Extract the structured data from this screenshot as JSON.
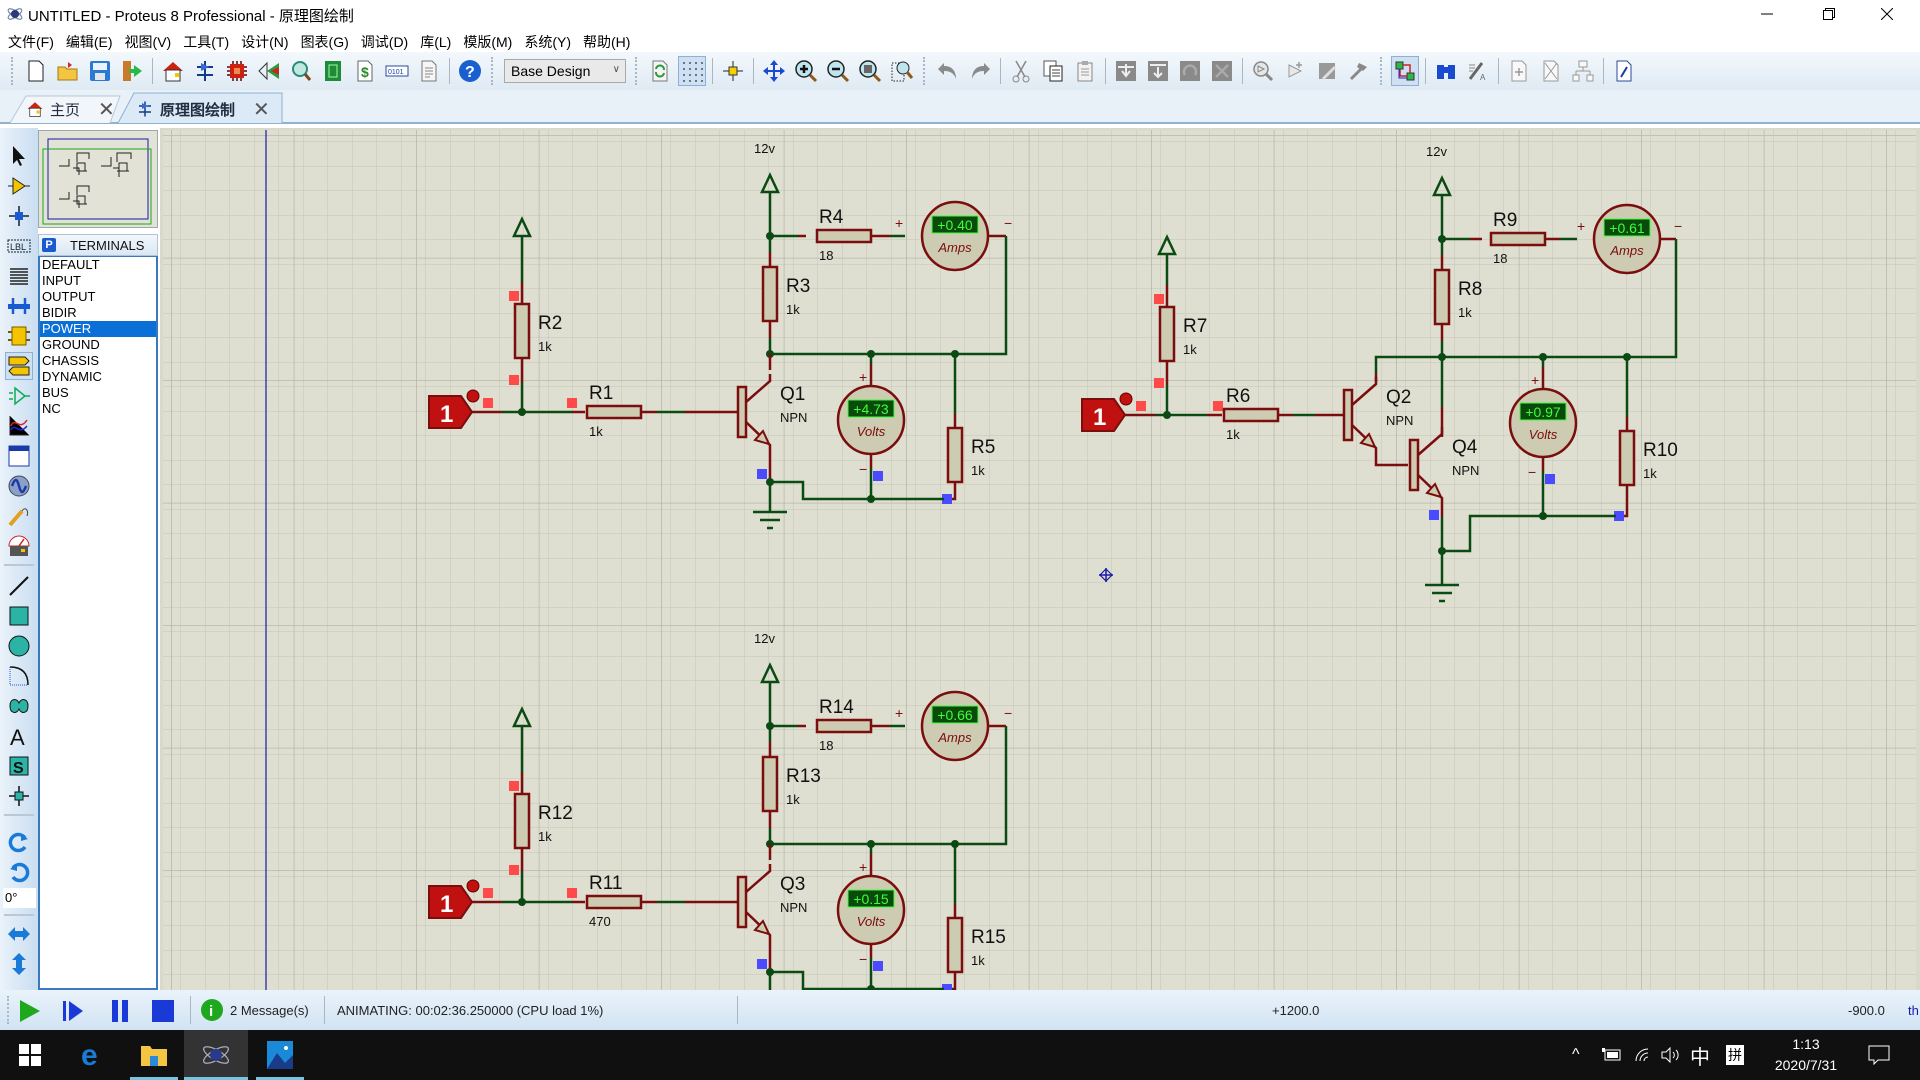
{
  "window": {
    "title": "UNTITLED - Proteus 8 Professional - 原理图绘制",
    "controls": {
      "minimize": "minimize-icon",
      "restore": "restore-icon",
      "close": "close-icon"
    }
  },
  "menu": [
    {
      "label": "文件(F)"
    },
    {
      "label": "编辑(E)"
    },
    {
      "label": "视图(V)"
    },
    {
      "label": "工具(T)"
    },
    {
      "label": "设计(N)"
    },
    {
      "label": "图表(G)"
    },
    {
      "label": "调试(D)"
    },
    {
      "label": "库(L)"
    },
    {
      "label": "模版(M)"
    },
    {
      "label": "系统(Y)"
    },
    {
      "label": "帮助(H)"
    }
  ],
  "toolbar": {
    "design_select": {
      "value": "Base Design"
    },
    "groups": [
      [
        "new-file-icon",
        "open-file-icon",
        "save-icon",
        "import-icon"
      ],
      [
        "home-icon",
        "schematic-icon",
        "pcb-icon",
        "3d-view-icon",
        "gerber-icon",
        "pcb-layout-icon",
        "bom-icon",
        "source-code-icon",
        "notes-icon"
      ],
      [
        "help-icon"
      ],
      [
        "refresh-icon",
        "grid-icon",
        "origin-icon",
        "pan-icon",
        "zoom-in-icon",
        "zoom-out-icon",
        "zoom-all-icon",
        "zoom-area-icon"
      ],
      [
        "undo-icon",
        "redo-icon",
        "cut-icon",
        "copy-icon",
        "paste-icon",
        "block-copy-icon",
        "block-move-icon",
        "block-rotate-icon",
        "block-delete-icon",
        "pick-device-icon",
        "make-device-icon",
        "package-tool-icon",
        "decompose-icon"
      ],
      [
        "wire-autoroute-icon",
        "search-icon",
        "property-assign-icon",
        "new-sheet-icon",
        "delete-sheet-icon",
        "exit-to-parent-icon",
        "design-explorer-icon"
      ]
    ]
  },
  "tabs": [
    {
      "label": "主页",
      "icon": "home-icon",
      "active": false
    },
    {
      "label": "原理图绘制",
      "icon": "schematic-icon",
      "active": true
    }
  ],
  "left_tools": [
    "selection-mode-icon",
    "component-mode-icon",
    "junction-dot-icon",
    "wire-label-icon",
    "text-script-icon",
    "bus-icon",
    "subcircuit-icon",
    "terminals-mode-icon",
    "device-pins-icon",
    "graph-mode-icon",
    "tape-recorder-icon",
    "generator-icon",
    "voltage-probe-icon",
    "virtual-instruments-icon",
    "line-icon",
    "box-icon",
    "circle-icon",
    "arc-icon",
    "path-icon",
    "text-icon",
    "symbol-icon",
    "marker-icon",
    "rotate-cw-icon",
    "rotate-ccw-icon",
    "flip-horizontal-icon",
    "flip-vertical-icon"
  ],
  "rotation_value": "0°",
  "terminals": {
    "badge": "P",
    "title": "TERMINALS",
    "items": [
      "DEFAULT",
      "INPUT",
      "OUTPUT",
      "BIDIR",
      "POWER",
      "GROUND",
      "CHASSIS",
      "DYNAMIC",
      "BUS",
      "NC"
    ],
    "selected": "POWER"
  },
  "schematic": {
    "circuits": [
      {
        "supply_label": "12v",
        "input_terminal": "1",
        "resistors": [
          {
            "ref": "R1",
            "value": "1k"
          },
          {
            "ref": "R2",
            "value": "1k"
          },
          {
            "ref": "R3",
            "value": "1k"
          },
          {
            "ref": "R4",
            "value": "18"
          },
          {
            "ref": "R5",
            "value": "1k"
          }
        ],
        "transistors": [
          {
            "ref": "Q1",
            "type": "NPN"
          }
        ],
        "ammeter": {
          "reading": "+0.40",
          "unit": "Amps"
        },
        "voltmeter": {
          "reading": "+4.73",
          "unit": "Volts"
        }
      },
      {
        "supply_label": "12v",
        "input_terminal": "1",
        "resistors": [
          {
            "ref": "R6",
            "value": "1k"
          },
          {
            "ref": "R7",
            "value": "1k"
          },
          {
            "ref": "R8",
            "value": "1k"
          },
          {
            "ref": "R9",
            "value": "18"
          },
          {
            "ref": "R10",
            "value": "1k"
          }
        ],
        "transistors": [
          {
            "ref": "Q2",
            "type": "NPN"
          },
          {
            "ref": "Q4",
            "type": "NPN"
          }
        ],
        "ammeter": {
          "reading": "+0.61",
          "unit": "Amps"
        },
        "voltmeter": {
          "reading": "+0.97",
          "unit": "Volts"
        }
      },
      {
        "supply_label": "12v",
        "input_terminal": "1",
        "resistors": [
          {
            "ref": "R11",
            "value": "470"
          },
          {
            "ref": "R12",
            "value": "1k"
          },
          {
            "ref": "R13",
            "value": "1k"
          },
          {
            "ref": "R14",
            "value": "18"
          },
          {
            "ref": "R15",
            "value": "1k"
          }
        ],
        "transistors": [
          {
            "ref": "Q3",
            "type": "NPN"
          }
        ],
        "ammeter": {
          "reading": "+0.66",
          "unit": "Amps"
        },
        "voltmeter": {
          "reading": "+0.15",
          "unit": "Volts"
        }
      }
    ],
    "plus_sign": "+",
    "minus_sign": "−"
  },
  "status": {
    "controls": [
      "play-icon",
      "step-icon",
      "pause-icon",
      "stop-icon"
    ],
    "messages": "2 Message(s)",
    "animation": "ANIMATING: 00:02:36.250000 (CPU load 1%)",
    "coord_x": "+1200.0",
    "coord_y": "-900.0",
    "units": "th"
  },
  "taskbar": {
    "apps": [
      "windows-start-icon",
      "edge-icon",
      "file-explorer-icon",
      "proteus-icon",
      "photos-icon"
    ],
    "tray": {
      "ime": "中",
      "ime_mode": "拼",
      "time": "1:13",
      "date": "2020/7/31"
    }
  },
  "colors": {
    "wire": "#0b4a12",
    "component": "#7a0d0d",
    "component_fill": "#cdcbb1",
    "canvas_bg": "#dfdfd1",
    "grid": "#c3c3b5",
    "lcd_bg": "#0a4a0a",
    "lcd_text": "#3dff3d",
    "selected_list": "#0a6fd6",
    "logic_high": "#ff4a4a",
    "logic_low": "#4a4aff"
  }
}
